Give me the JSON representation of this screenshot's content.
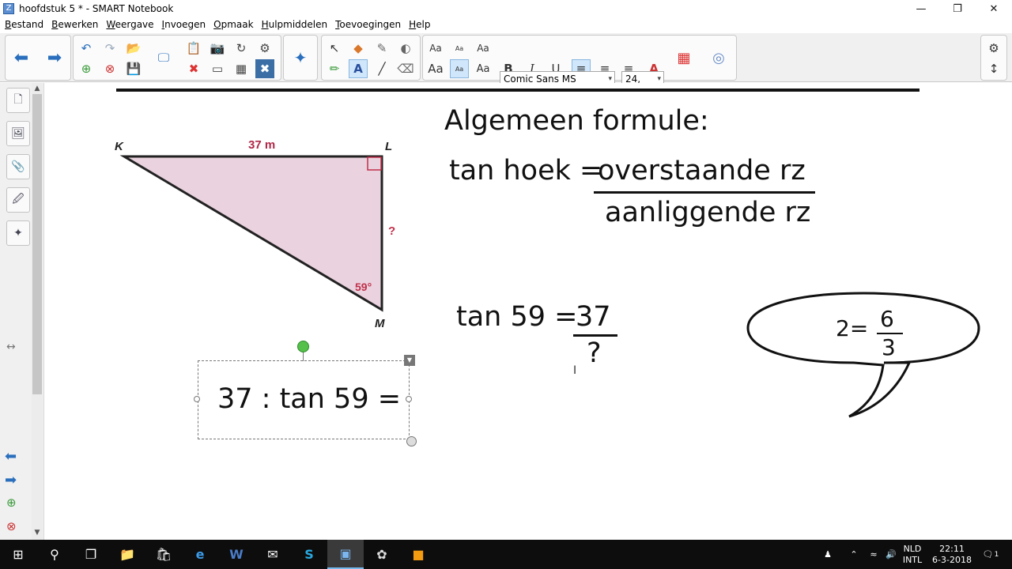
{
  "window": {
    "title": "hoofdstuk 5 * - SMART Notebook",
    "minimize": "—",
    "restore": "❐",
    "close": "✕"
  },
  "menu": [
    "Bestand",
    "Bewerken",
    "Weergave",
    "Invoegen",
    "Opmaak",
    "Hulpmiddelen",
    "Toevoegingen",
    "Help"
  ],
  "toolbar": {
    "font_name": "Comic Sans MS",
    "font_size": "24,",
    "text_style_aa": "Aa",
    "bold": "B",
    "italic": "I",
    "underline": "U"
  },
  "triangle": {
    "vertex_k": "K",
    "vertex_l": "L",
    "vertex_m": "M",
    "side_kl": "37 m",
    "side_lm": "?",
    "angle_m": "59°",
    "fill_color": "#ead2df",
    "accent_color": "#c0304a"
  },
  "formula": {
    "heading": "Algemeen formule:",
    "lhs": "tan hoek =",
    "numerator": "overstaande rz",
    "denominator": "aanliggende rz"
  },
  "equation": {
    "lhs": "tan 59 =",
    "numerator": "37",
    "denominator": "?"
  },
  "selected_textbox": {
    "text": "37 : tan 59 ="
  },
  "speech_bubble": {
    "lhs": "2=",
    "numerator": "6",
    "denominator": "3"
  },
  "taskbar": {
    "language": "NLD",
    "layout": "INTL",
    "time": "22:11",
    "date": "6-3-2018",
    "notification_count": "1"
  }
}
